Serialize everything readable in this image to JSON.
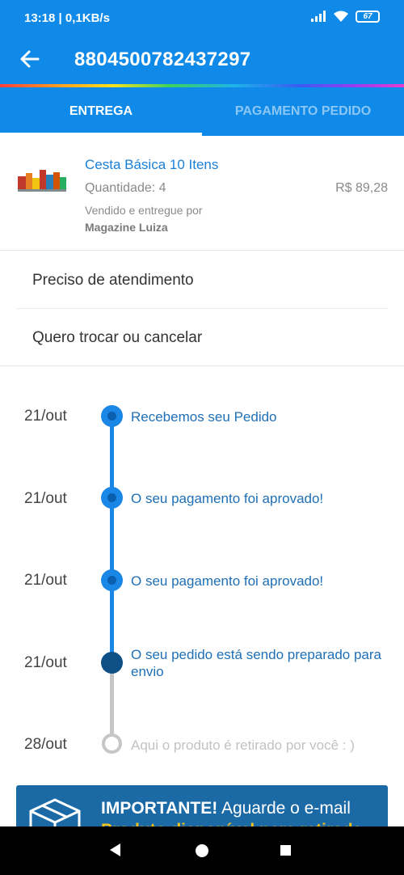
{
  "status_bar": {
    "time": "13:18 | 0,1KB/s",
    "battery": "67",
    "icons": [
      "signal-icon",
      "wifi-icon",
      "battery-icon"
    ]
  },
  "header": {
    "order_number": "8804500782437297",
    "back_icon": "arrow-left-icon"
  },
  "tabs": [
    {
      "label": "ENTREGA",
      "active": true
    },
    {
      "label": "PAGAMENTO PEDIDO",
      "active": false
    }
  ],
  "product": {
    "name": "Cesta Básica 10 Itens",
    "quantity": "Quantidade: 4",
    "price": "R$ 89,28",
    "seller_label": "Vendido e entregue por",
    "seller": "Magazine Luiza"
  },
  "options": [
    {
      "label": "Preciso de atendimento"
    },
    {
      "label": "Quero trocar ou cancelar"
    }
  ],
  "timeline": [
    {
      "date": "21/out",
      "text": "Recebemos seu Pedido",
      "status": "done"
    },
    {
      "date": "21/out",
      "text": "O seu pagamento foi aprovado!",
      "status": "done"
    },
    {
      "date": "21/out",
      "text": "O seu pagamento foi aprovado!",
      "status": "done"
    },
    {
      "date": "21/out",
      "text": "O seu pedido está sendo preparado para envio",
      "status": "current"
    },
    {
      "date": "28/out",
      "text": "Aqui o produto é retirado por você : )",
      "status": "pending"
    }
  ],
  "important": {
    "title": "IMPORTANTE!",
    "text": " Aguarde o e-mail",
    "subtext": "Produto disponível para retirada"
  },
  "colors": {
    "primary": "#0f8ae8",
    "timeline_blue": "#1a86e6",
    "banner": "#1b6aa6",
    "highlight": "#f6c21a"
  }
}
